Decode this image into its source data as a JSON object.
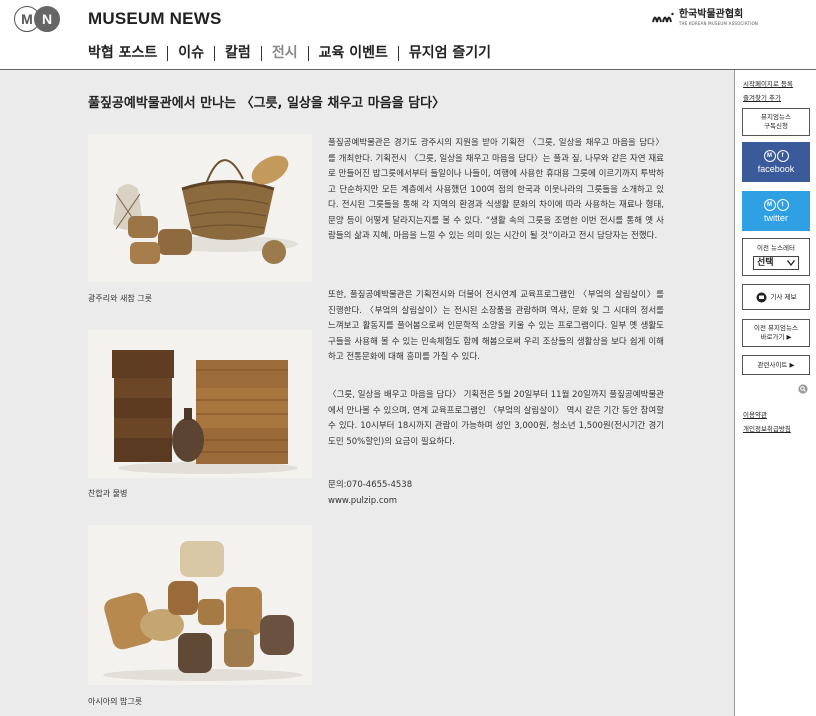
{
  "header": {
    "logo_letters": [
      "M",
      "N"
    ],
    "brand": "MUSEUM NEWS",
    "association": {
      "mark": "kma",
      "name_ko": "한국박물관협회",
      "name_en": "THE KOREAN MUSEUM ASSOCIATION"
    },
    "nav": [
      {
        "label": "박협 포스트",
        "active": false
      },
      {
        "label": "이슈",
        "active": false
      },
      {
        "label": "칼럼",
        "active": false
      },
      {
        "label": "전시",
        "active": true
      },
      {
        "label": "교육 이벤트",
        "active": false
      },
      {
        "label": "뮤지엄 즐기기",
        "active": false
      }
    ]
  },
  "article": {
    "title": "풀짚공예박물관에서 만나는 〈그릇, 일상을 채우고 마음을 담다〉",
    "images": [
      {
        "caption": "광주리와 새참 그릇"
      },
      {
        "caption": "찬합과 물병"
      },
      {
        "caption": "아시아의 밥그릇"
      }
    ],
    "paragraphs": [
      "풀짚공예박물관은 경기도 광주시의 지원을 받아 기획전 〈그릇, 일상을 채우고 마음을 담다〉를 개최한다. 기획전시 〈그릇, 일상을 채우고 마음을 담다〉는 풀과 짚, 나무와 같은 자연 재료로 만들어진 밥그릇에서부터 들일이나 나들이, 여행에 사용한 휴대용 그릇에 이르기까지 투박하고 단순하지만 모든 계층에서 사용했던 100여 점의 한국과 이웃나라의 그릇들을 소개하고 있다. 전시된 그릇들을 통해 각 지역의 환경과 식생활 문화의 차이에 따라 사용하는 재료나 형태, 문양 등이 어떻게 달라지는지를 볼 수 있다. “생활 속의 그릇을 조명한 이번 전시를 통해 옛 사람들의 삶과 지혜, 마음을 느낄 수 있는 의미 있는 시간이 될 것”이라고 전시 담당자는 전했다.",
      "또한, 풀짚공예박물관은 기획전시와 더불어 전시연계 교육프로그램인 〈부엌의 살림살이〉를 진행한다. 〈부엌의 살림살이〉는 전시된 소장품을 관람하며 역사, 문화 및 그 시대의 정서를 느껴보고 활동지를 풀어봄으로써 인문학적 소양을 키울 수 있는 프로그램이다. 일부 옛 생활도구들을 사용해 볼 수 있는 민속체험도 함께 해봄으로써 우리 조상들의 생활상을 보다 쉽게 이해하고 전통문화에 대해 흥미를 가질 수 있다.",
      "〈그릇, 일상을 배우고 마음을 담다〉 기획전은 5월 20일부터 11월 20일까지 풀짚공예박물관에서 만나볼 수 있으며, 연계 교육프로그램인 〈부엌의 살림살이〉 역시 같은 기간 동안 참여할 수 있다. 10시부터 18시까지 관람이 가능하며 성인 3,000원, 청소년 1,500원(전시기간 경기도민 50%할인)의 요금이 필요하다.",
      "문의:070-4655-4538",
      "www.pulzip.com"
    ]
  },
  "sidebar": {
    "bookmark_line1": "시작페이지로 등록",
    "bookmark_line2": "즐겨찾기 추가",
    "subscribe_line1": "뮤지엄뉴스",
    "subscribe_line2": "구독신청",
    "facebook_label": "facebook",
    "twitter_label": "twitter",
    "prev_newsletter": "이전 뉴스레터",
    "select_value": "선택",
    "report_label": "기사 제보",
    "prev_museum_line1": "이전 뮤지엄뉴스",
    "prev_museum_line2": "바로가기 ▶",
    "related_sites": "관련사이트 ▶",
    "terms": "이용약관",
    "privacy": "개인정보취급방침"
  },
  "colors": {
    "facebook": "#3b5a9a",
    "twitter": "#2fa0e4",
    "content_bg": "#ebebeb",
    "nav_active": "#888888"
  }
}
